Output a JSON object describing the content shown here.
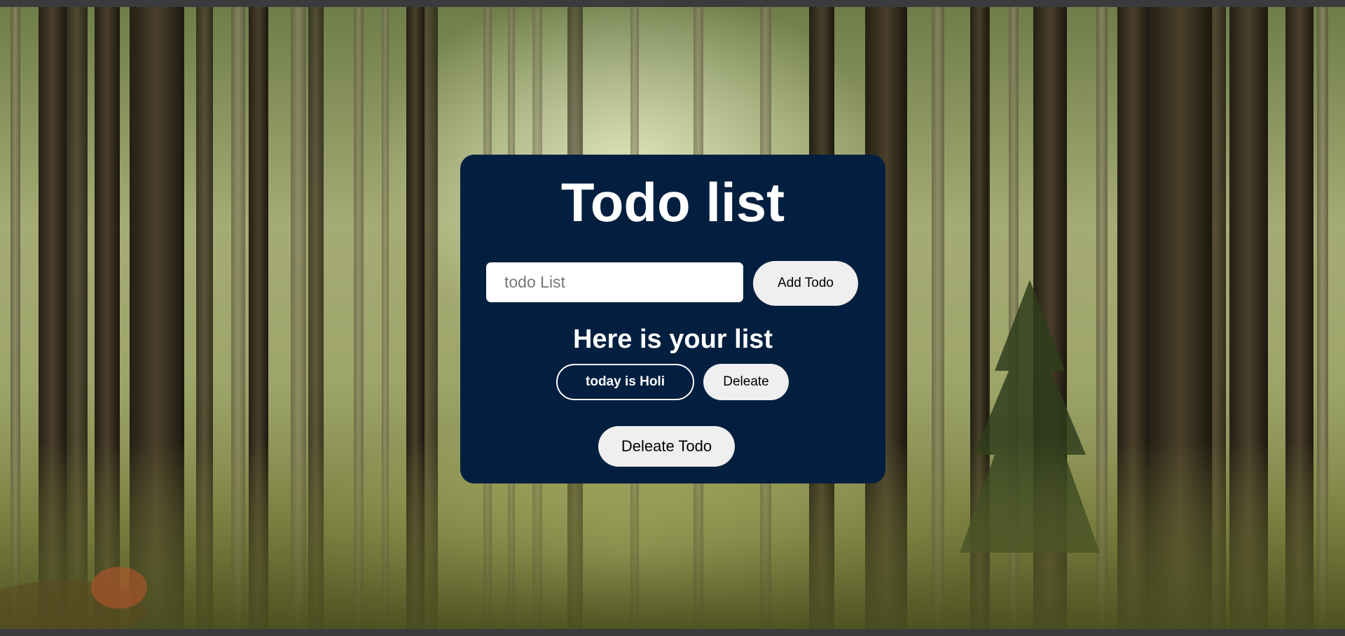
{
  "background": {
    "scene": "forest",
    "colors": {
      "trunk_dark": "#2e2a1e",
      "trunk_mid": "#4a3f2a",
      "trunk_light": "#6b6147",
      "haze": "#e8f0c8"
    }
  },
  "card": {
    "background_color": "#021f3f",
    "title": "Todo list",
    "input": {
      "placeholder": "todo List",
      "value": ""
    },
    "add_button_label": "Add Todo",
    "list_heading": "Here is your list",
    "items": [
      {
        "text": "today is Holi",
        "delete_label": "Deleate"
      }
    ],
    "delete_all_label": "Deleate Todo"
  }
}
